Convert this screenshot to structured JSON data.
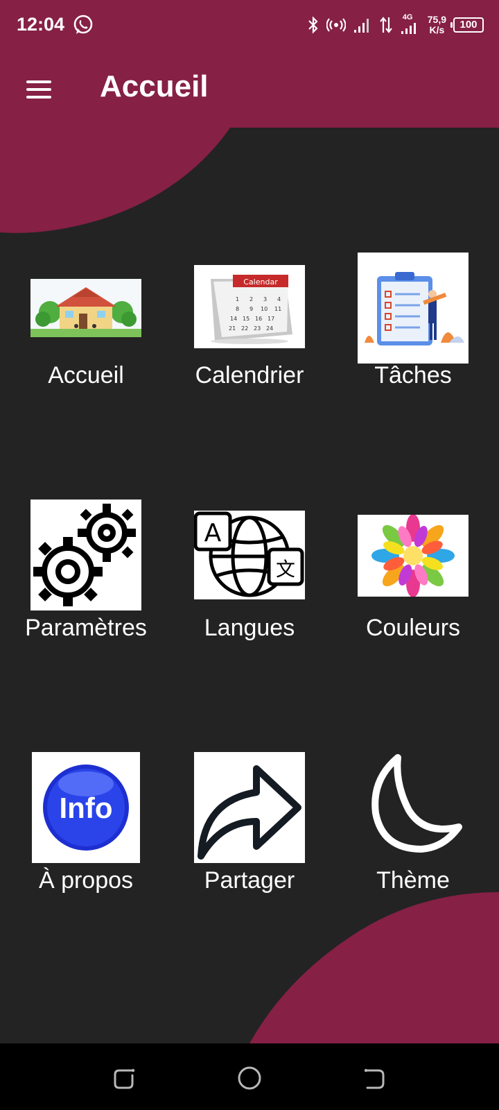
{
  "status": {
    "time": "12:04",
    "network": "4G",
    "speed_value": "75,9",
    "speed_unit": "K/s",
    "battery": "100"
  },
  "app_bar": {
    "title": "Accueil"
  },
  "colors": {
    "accent": "#862045",
    "background": "#232323"
  },
  "tiles": [
    {
      "label": "Accueil",
      "icon": "house-icon"
    },
    {
      "label": "Calendrier",
      "icon": "calendar-icon"
    },
    {
      "label": "Tâches",
      "icon": "clipboard-tasks-icon"
    },
    {
      "label": "Paramètres",
      "icon": "gears-icon"
    },
    {
      "label": "Langues",
      "icon": "language-globe-icon"
    },
    {
      "label": "Couleurs",
      "icon": "flower-icon"
    },
    {
      "label": "À propos",
      "icon": "info-icon"
    },
    {
      "label": "Partager",
      "icon": "share-arrow-icon"
    },
    {
      "label": "Thème",
      "icon": "moon-icon"
    }
  ],
  "calendar_image_text": "Calendar",
  "info_image_text": "Info"
}
